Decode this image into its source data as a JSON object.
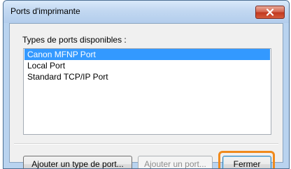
{
  "window": {
    "title": "Ports d'imprimante"
  },
  "close_button": {
    "icon": "close-icon"
  },
  "ports": {
    "label": "Types de ports disponibles :",
    "items": [
      {
        "label": "Canon MFNP Port",
        "selected": true
      },
      {
        "label": "Local Port",
        "selected": false
      },
      {
        "label": "Standard TCP/IP Port",
        "selected": false
      }
    ]
  },
  "buttons": {
    "add_type": "Ajouter un type de port...",
    "add_port": "Ajouter un port...",
    "close": "Fermer"
  },
  "colors": {
    "selection": "#3399ff",
    "highlight": "#f08a1c",
    "close_button": "#c1371f"
  }
}
